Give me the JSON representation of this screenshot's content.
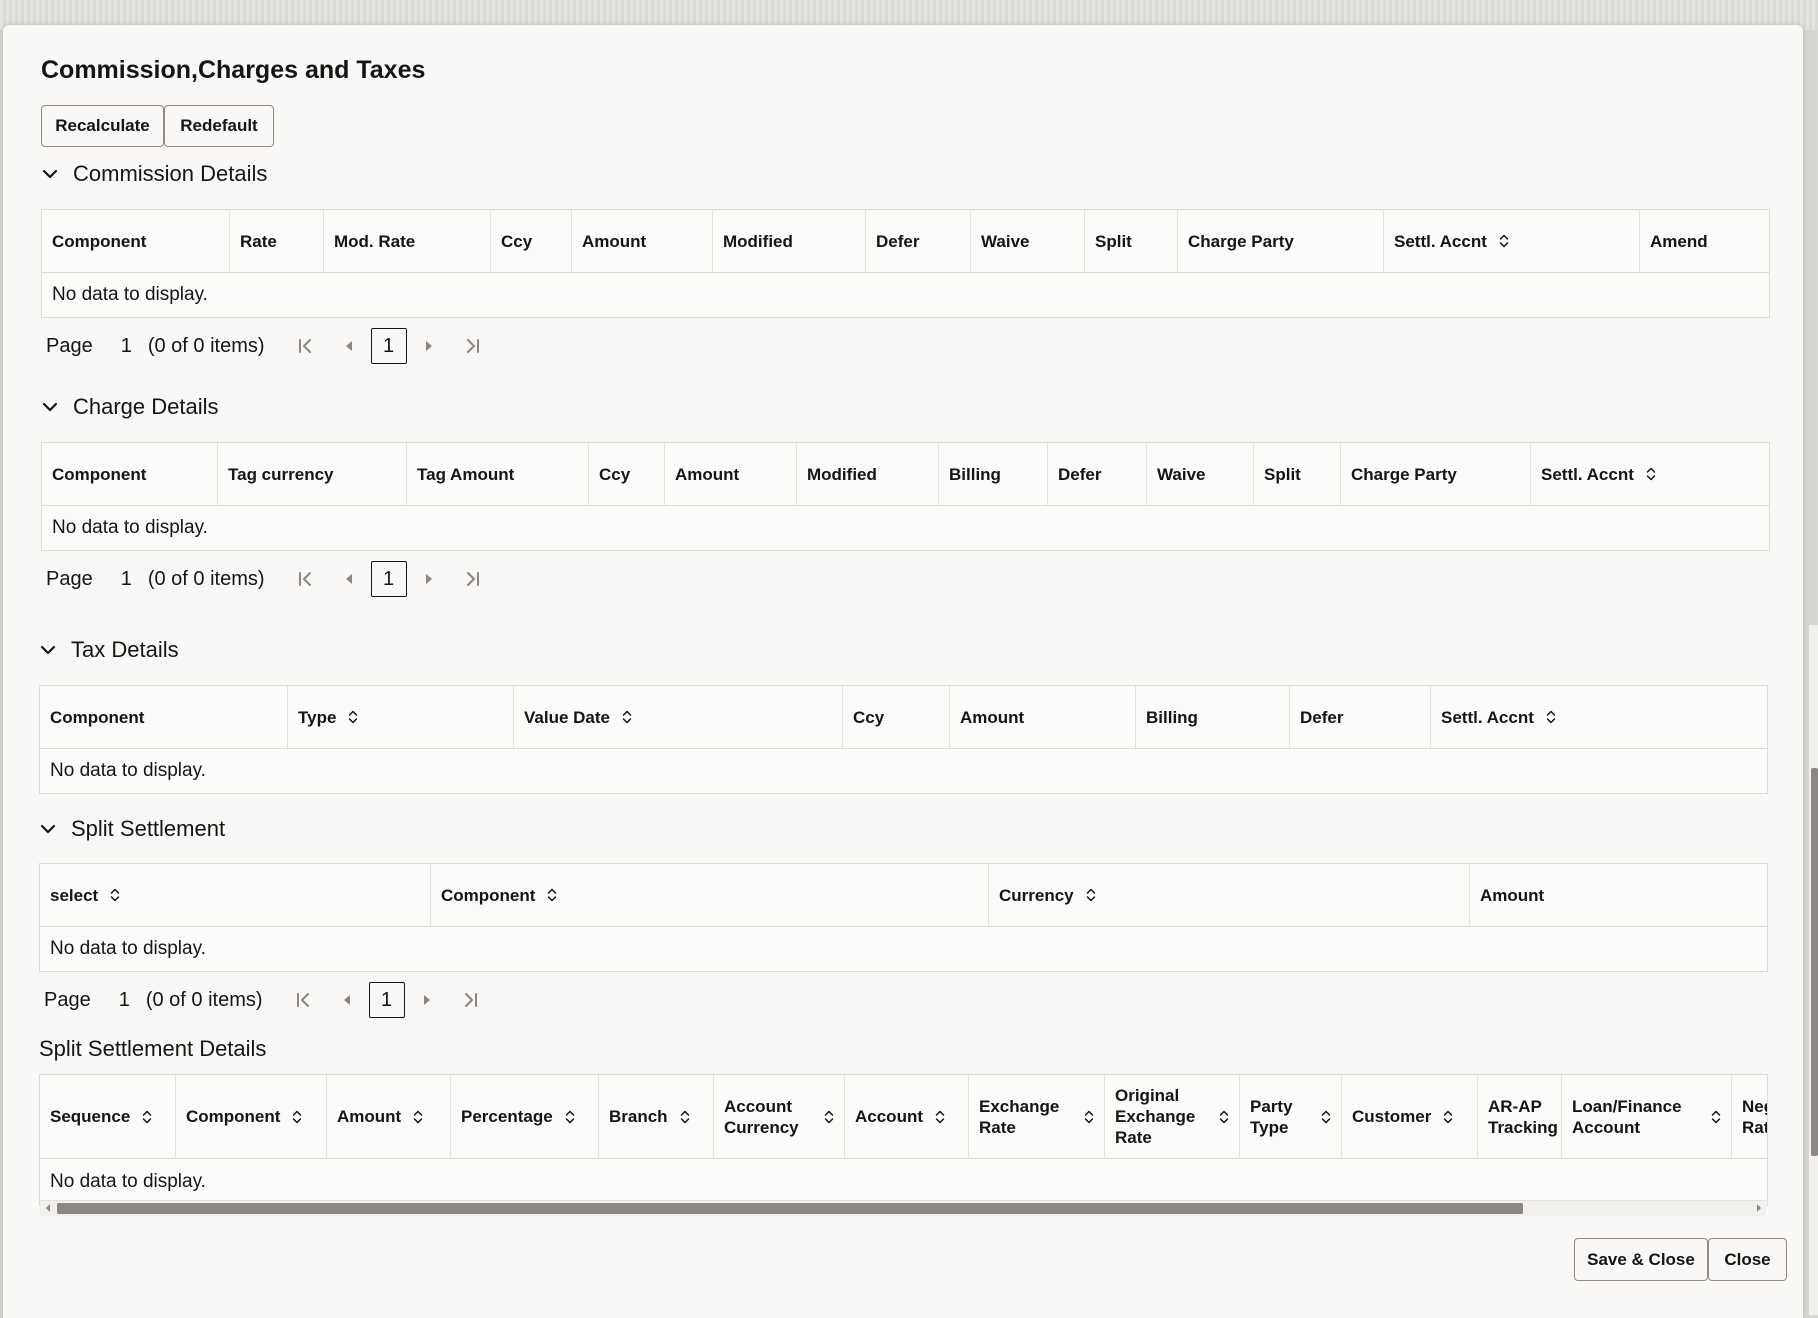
{
  "dialog": {
    "title": "Commission,Charges and Taxes",
    "buttons": {
      "recalculate": "Recalculate",
      "redefault": "Redefault"
    },
    "footer": {
      "save_close": "Save & Close",
      "close": "Close"
    }
  },
  "sections": {
    "commission": {
      "title": "Commission Details",
      "columns": [
        "Component",
        "Rate",
        "Mod. Rate",
        "Ccy",
        "Amount",
        "Modified",
        "Defer",
        "Waive",
        "Split",
        "Charge Party",
        "Settl. Accnt",
        "Amend"
      ],
      "sortable": [
        "Settl. Accnt"
      ],
      "empty": "No data to display.",
      "pager": {
        "label": "Page",
        "page": "1",
        "items": "(0 of 0 items)",
        "current": "1"
      }
    },
    "charge": {
      "title": "Charge Details",
      "columns": [
        "Component",
        "Tag currency",
        "Tag Amount",
        "Ccy",
        "Amount",
        "Modified",
        "Billing",
        "Defer",
        "Waive",
        "Split",
        "Charge Party",
        "Settl. Accnt"
      ],
      "sortable": [
        "Settl. Accnt"
      ],
      "empty": "No data to display.",
      "pager": {
        "label": "Page",
        "page": "1",
        "items": "(0 of 0 items)",
        "current": "1"
      }
    },
    "tax": {
      "title": "Tax Details",
      "columns": [
        "Component",
        "Type",
        "Value Date",
        "Ccy",
        "Amount",
        "Billing",
        "Defer",
        "Settl. Accnt"
      ],
      "sortable": [
        "Type",
        "Value Date",
        "Settl. Accnt"
      ],
      "empty": "No data to display."
    },
    "split": {
      "title": "Split Settlement",
      "columns": [
        "select",
        "Component",
        "Currency",
        "Amount"
      ],
      "sortable": [
        "select",
        "Component",
        "Currency"
      ],
      "empty": "No data to display.",
      "pager": {
        "label": "Page",
        "page": "1",
        "items": "(0 of 0 items)",
        "current": "1"
      }
    },
    "split_details": {
      "title": "Split Settlement Details",
      "columns": [
        "Sequence",
        "Component",
        "Amount",
        "Percentage",
        "Branch",
        "Account Currency",
        "Account",
        "Exchange Rate",
        "Original Exchange Rate",
        "Party Type",
        "Customer",
        "AR-AP Tracking",
        "Loan/Finance Account",
        "Neg Rat"
      ],
      "sortable": [
        "Sequence",
        "Component",
        "Amount",
        "Percentage",
        "Branch",
        "Account Currency",
        "Account",
        "Exchange Rate",
        "Original Exchange Rate",
        "Party Type",
        "Customer",
        "Loan/Finance Account"
      ],
      "empty": "No data to display."
    }
  }
}
